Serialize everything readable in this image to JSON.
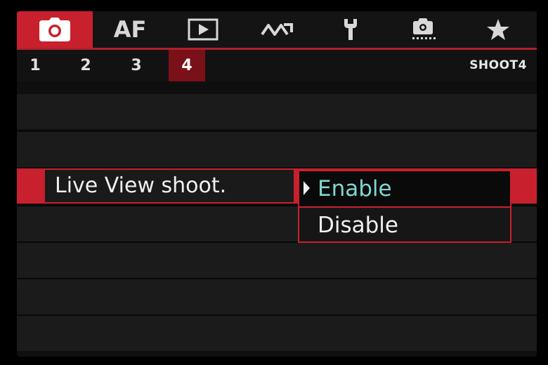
{
  "tabs": [
    {
      "id": "shoot",
      "icon": "camera-icon"
    },
    {
      "id": "af",
      "label": "AF"
    },
    {
      "id": "playback",
      "icon": "play-icon"
    },
    {
      "id": "wireless",
      "icon": "wireless-icon"
    },
    {
      "id": "setup",
      "icon": "wrench-icon"
    },
    {
      "id": "custom",
      "icon": "custom-function-icon"
    },
    {
      "id": "my-menu",
      "icon": "star-icon"
    }
  ],
  "active_tab": "shoot",
  "subtabs": [
    "1",
    "2",
    "3",
    "4"
  ],
  "active_subtab": "4",
  "page_label": "SHOOT4",
  "setting": {
    "label": "Live View shoot.",
    "options": [
      "Enable",
      "Disable"
    ],
    "selected": "Enable"
  },
  "colors": {
    "accent": "#c8202c",
    "selected_option_text": "#7fd6d0"
  }
}
